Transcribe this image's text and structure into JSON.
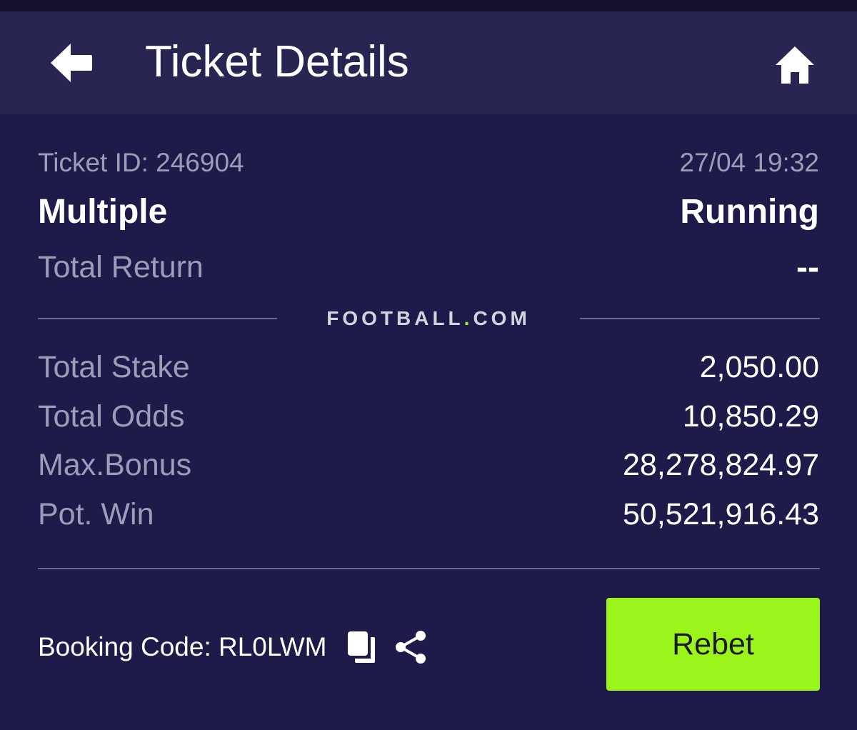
{
  "header": {
    "title": "Ticket Details"
  },
  "ticket": {
    "id_label": "Ticket ID: 246904",
    "datetime": "27/04 19:32",
    "bet_type": "Multiple",
    "status": "Running",
    "total_return_label": "Total Return",
    "total_return_value": "--"
  },
  "brand": {
    "name_part1": "FOOTBALL",
    "dot": ".",
    "name_part2": "COM"
  },
  "summary": [
    {
      "label": "Total Stake",
      "value": "2,050.00"
    },
    {
      "label": "Total Odds",
      "value": "10,850.29"
    },
    {
      "label": "Max.Bonus",
      "value": "28,278,824.97"
    },
    {
      "label": "Pot. Win",
      "value": "50,521,916.43"
    }
  ],
  "booking": {
    "text": "Booking Code: RL0LWM"
  },
  "actions": {
    "rebet_label": "Rebet"
  },
  "colors": {
    "background": "#1e1a4a",
    "header": "#282552",
    "accent": "#9cf51a",
    "muted_text": "#9e9cb9"
  },
  "icons": {
    "back": "arrow-left-icon",
    "home": "home-icon",
    "copy": "copy-icon",
    "share": "share-icon"
  }
}
